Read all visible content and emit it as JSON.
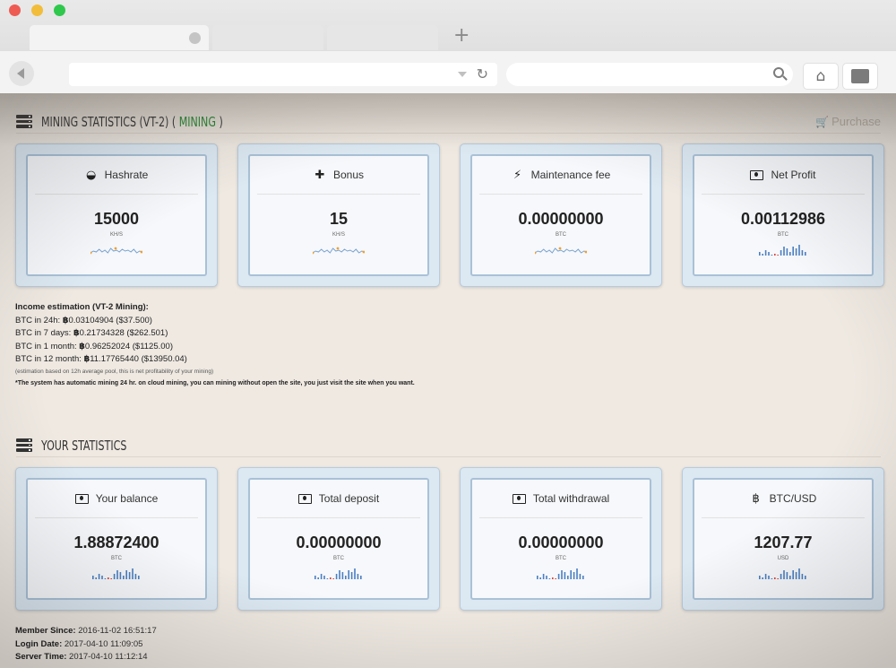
{
  "browser": {
    "tabs": [
      {
        "label": ""
      },
      {
        "label": ""
      },
      {
        "label": ""
      }
    ],
    "new_tab_glyph": "+",
    "url": "",
    "search": ""
  },
  "mining": {
    "title": "MINING STATISTICS (VT-2) (",
    "status": "MINING",
    "title_close": ")",
    "purchase_label": "Purchase",
    "cards": [
      {
        "icon": "dashboard-icon",
        "label": "Hashrate",
        "value": "15000",
        "unit": "KH/S",
        "spark": "orange-line"
      },
      {
        "icon": "plus-icon",
        "label": "Bonus",
        "value": "15",
        "unit": "KH/S",
        "spark": "orange-line"
      },
      {
        "icon": "plug-icon",
        "label": "Maintenance fee",
        "value": "0.00000000",
        "unit": "BTC",
        "spark": "orange-line"
      },
      {
        "icon": "money-icon",
        "label": "Net Profit",
        "value": "0.00112986",
        "unit": "BTC",
        "spark": "blue-bars"
      }
    ]
  },
  "income": {
    "title": "Income estimation (VT-2 Mining):",
    "lines": [
      {
        "label": "BTC in 24h:",
        "btc": "0.03104904",
        "usd": "($37.500)"
      },
      {
        "label": "BTC in 7 days:",
        "btc": "0.21734328",
        "usd": "($262.501)"
      },
      {
        "label": "BTC in 1 month:",
        "btc": "0.96252024",
        "usd": "($1125.00)"
      },
      {
        "label": "BTC in 12 month:",
        "btc": "11.17765440",
        "usd": "($13950.04)"
      }
    ],
    "btc_symbol": "฿",
    "note": "(estimation based on 12h average pool, this is net profitability of your mining)",
    "bold_note": "*The system has automatic mining 24 hr. on cloud mining, you can mining without open the site, you just visit the site when you want."
  },
  "your_stats": {
    "title": "YOUR STATISTICS",
    "cards": [
      {
        "icon": "money-icon",
        "label": "Your balance",
        "value": "1.88872400",
        "unit": "BTC",
        "spark": "blue-bars"
      },
      {
        "icon": "money-icon",
        "label": "Total deposit",
        "value": "0.00000000",
        "unit": "BTC",
        "spark": "blue-bars"
      },
      {
        "icon": "money-icon",
        "label": "Total withdrawal",
        "value": "0.00000000",
        "unit": "BTC",
        "spark": "blue-bars"
      },
      {
        "icon": "bitcoin-icon",
        "label": "BTC/USD",
        "value": "1207.77",
        "unit": "USD",
        "spark": "blue-bars"
      }
    ]
  },
  "member": {
    "since_label": "Member Since:",
    "since": "2016-11-02 16:51:17",
    "login_label": "Login Date:",
    "login": "2017-04-10 11:09:05",
    "server_label": "Server Time:",
    "server": "2017-04-10 11:12:14"
  },
  "icons": {
    "dashboard-icon": "◒",
    "plus-icon": "✚",
    "plug-icon": "⚡",
    "bitcoin-icon": "฿"
  }
}
